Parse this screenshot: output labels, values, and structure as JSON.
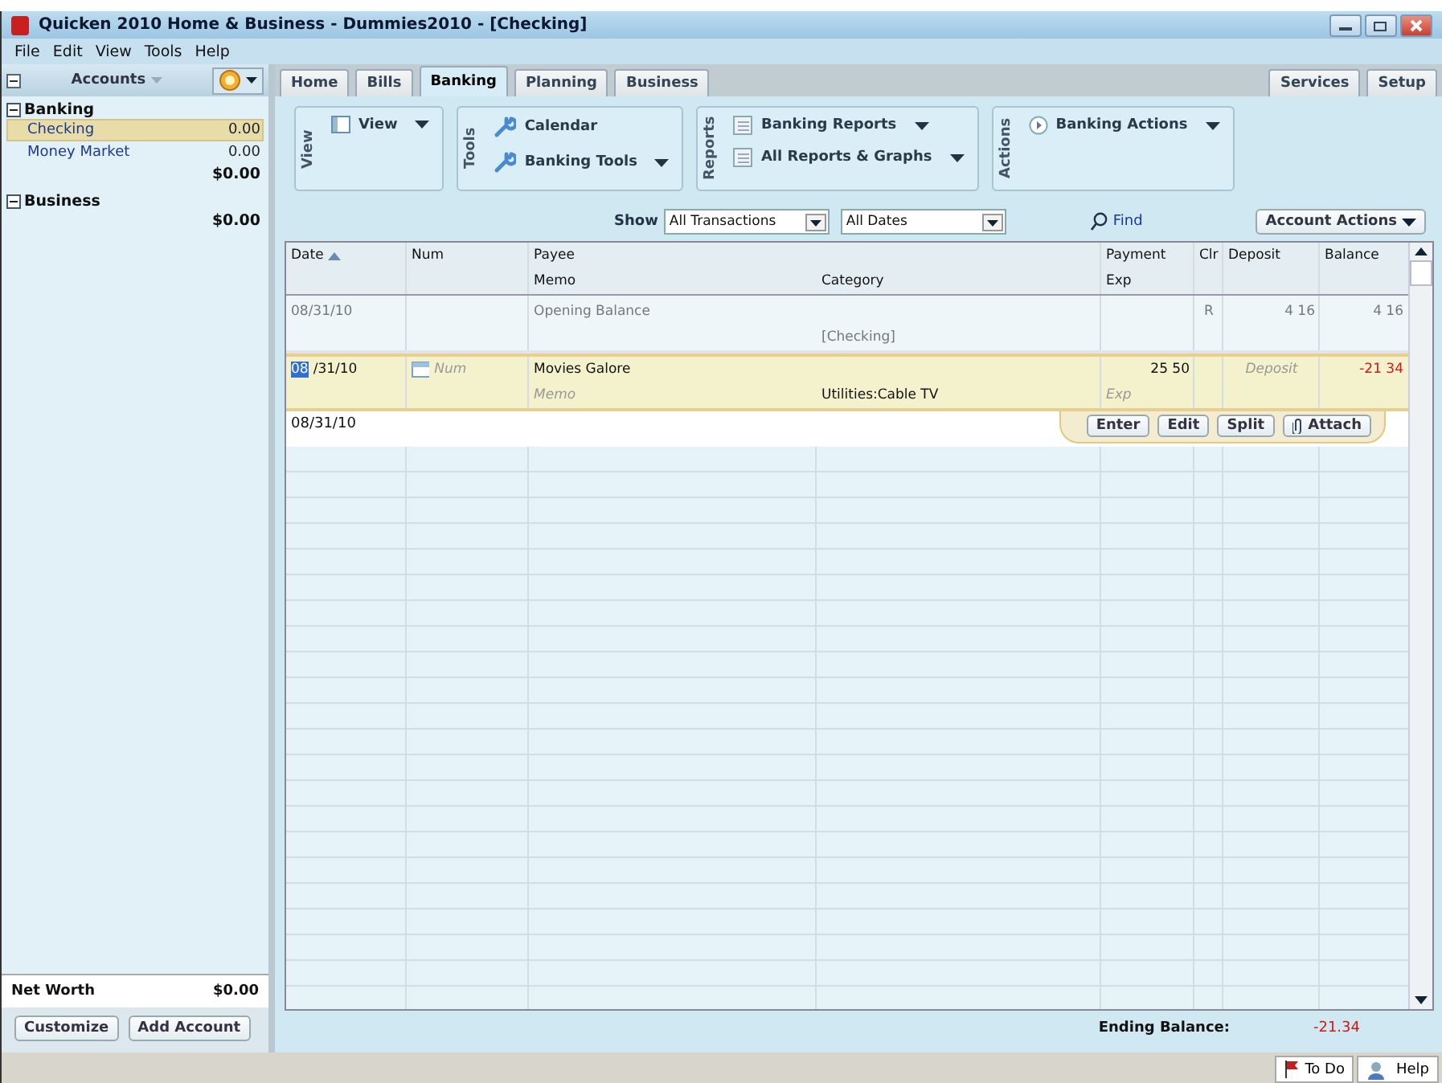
{
  "window": {
    "title": "Quicken 2010 Home & Business - Dummies2010 - [Checking]"
  },
  "menu": [
    "File",
    "Edit",
    "View",
    "Tools",
    "Help"
  ],
  "sidebar": {
    "header": "Accounts",
    "groups": [
      {
        "name": "Banking",
        "expanded": true,
        "accounts": [
          {
            "name": "Checking",
            "amount": "0.00",
            "selected": true
          },
          {
            "name": "Money Market",
            "amount": "0.00",
            "selected": false
          }
        ],
        "total": "$0.00"
      },
      {
        "name": "Business",
        "expanded": true,
        "total": "$0.00"
      }
    ],
    "net_worth": {
      "label": "Net Worth",
      "value": "$0.00"
    },
    "buttons": [
      "Customize",
      "Add Account"
    ]
  },
  "tabs": [
    {
      "label": "Home",
      "selected": false
    },
    {
      "label": "Bills",
      "selected": false
    },
    {
      "label": "Banking",
      "selected": true
    },
    {
      "label": "Planning",
      "selected": false
    },
    {
      "label": "Business",
      "selected": false
    }
  ],
  "right_tabs": [
    {
      "label": "Services",
      "selected": false
    },
    {
      "label": "Setup",
      "selected": false
    }
  ],
  "toolbar": [
    {
      "label": "View",
      "items": [
        {
          "label": "View",
          "kind": "window",
          "dropdown": true
        }
      ]
    },
    {
      "label": "Tools",
      "items": [
        {
          "label": "Calendar",
          "kind": "wrench",
          "dropdown": false
        },
        {
          "label": "Banking Tools",
          "kind": "wrench",
          "dropdown": true
        }
      ]
    },
    {
      "label": "Reports",
      "items": [
        {
          "label": "Banking Reports",
          "kind": "report",
          "dropdown": true
        },
        {
          "label": "All Reports & Graphs",
          "kind": "report",
          "dropdown": true
        }
      ]
    },
    {
      "label": "Actions",
      "items": [
        {
          "label": "Banking Actions",
          "kind": "play",
          "dropdown": true
        }
      ]
    }
  ],
  "filters": {
    "show_label": "Show",
    "selects": [
      "All Transactions",
      "All Dates"
    ],
    "find": "Find",
    "account_actions": "Account Actions"
  },
  "register": {
    "header": {
      "date": "Date",
      "num": "Num",
      "payee": "Payee",
      "memo": "Memo",
      "category": "Category",
      "payment": "Payment",
      "exp": "Exp",
      "clr": "Clr",
      "deposit": "Deposit",
      "balance": "Balance"
    },
    "transactions": [
      {
        "editing": false,
        "date": "08/31/10",
        "payee": "Opening Balance",
        "category": "[Checking]",
        "clr": "R",
        "deposit": "4 16",
        "balance": "4 16",
        "negative": false
      },
      {
        "editing": true,
        "date_selected": "08",
        "date_rest": "/31/10",
        "num": {
          "placeholder": "Num"
        },
        "payee": "Movies Galore",
        "memo": {
          "placeholder": "Memo"
        },
        "category": "Utilities:Cable TV",
        "payment": "25 50",
        "exp": {
          "placeholder": "Exp"
        },
        "deposit": {
          "placeholder": "Deposit"
        },
        "balance": "-21 34",
        "negative": true
      }
    ],
    "new_date": "08/31/10",
    "edit_buttons": [
      "Enter",
      "Edit",
      "Split",
      "Attach"
    ],
    "ending_balance": {
      "label": "Ending Balance:",
      "value": "-21.34"
    }
  },
  "status_bar": [
    "To Do",
    "Help"
  ]
}
